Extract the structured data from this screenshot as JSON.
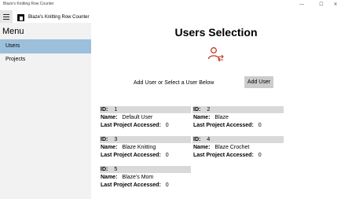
{
  "window": {
    "title": "Blaze's Knitting Row Counter",
    "minimize": "—",
    "maximize": "☐",
    "close": "✕"
  },
  "app": {
    "title": "Blaze's Knitting Row Counter"
  },
  "sidebar": {
    "menu_label": "Menu",
    "items": [
      {
        "label": "Users"
      },
      {
        "label": "Projects"
      }
    ]
  },
  "main": {
    "title": "Users Selection",
    "prompt": "Add User or Select a User Below",
    "add_user_label": "Add User",
    "id_label": "ID:",
    "name_label": "Name:",
    "last_label": "Last Project Accessed:",
    "users": [
      {
        "id": "1",
        "name": "Default User",
        "last": "0"
      },
      {
        "id": "2",
        "name": "Blaze",
        "last": "0"
      },
      {
        "id": "3",
        "name": "Blaze Knitting",
        "last": "0"
      },
      {
        "id": "4",
        "name": "Blaze Crochet",
        "last": "0"
      },
      {
        "id": "5",
        "name": "Blaze's Mom",
        "last": "0"
      }
    ]
  },
  "colors": {
    "selected_nav": "#9cbfdc",
    "icon_accent": "#c0392b",
    "card_header": "#d9d9d9"
  }
}
